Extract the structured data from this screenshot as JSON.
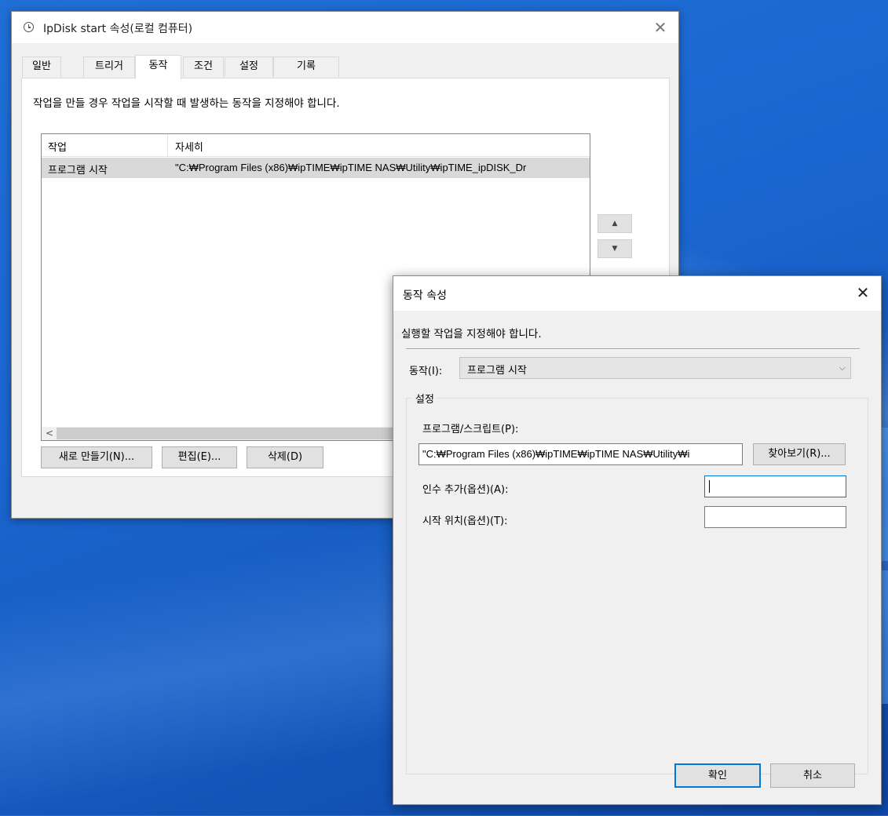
{
  "main_window": {
    "title": "IpDisk start 속성(로컬 컴퓨터)",
    "close_glyph": "✕",
    "icon": "clock-icon",
    "tabs": [
      {
        "label": "일반"
      },
      {
        "label": "트리거"
      },
      {
        "label": "동작",
        "active": true
      },
      {
        "label": "조건"
      },
      {
        "label": "설정"
      },
      {
        "label": "기록"
      }
    ],
    "description": "작업을 만들 경우 작업을 시작할 때 발생하는 동작을 지정해야 합니다.",
    "list": {
      "columns": [
        "작업",
        "자세히"
      ],
      "rows": [
        {
          "action": "프로그램 시작",
          "details": "\"C:₩Program Files (x86)₩ipTIME₩ipTIME NAS₩Utility₩ipTIME_ipDISK_Dr"
        }
      ]
    },
    "move_up_glyph": "▲",
    "move_down_glyph": "▼",
    "scroll_left_glyph": "<",
    "buttons": {
      "new": "새로 만들기(N)...",
      "edit": "편집(E)...",
      "delete": "삭제(D)"
    }
  },
  "action_dialog": {
    "title": "동작 속성",
    "close_glyph": "✕",
    "description": "실행할 작업을 지정해야 합니다.",
    "action_label": "동작(I):",
    "action_value": "프로그램 시작",
    "chevron_glyph": "⌵",
    "group_title": "설정",
    "program_label": "프로그램/스크립트(P):",
    "program_value": "\"C:₩Program Files (x86)₩ipTIME₩ipTIME NAS₩Utility₩i",
    "browse_label": "찾아보기(R)...",
    "args_label": "인수 추가(옵션)(A):",
    "args_value": "",
    "start_in_label": "시작 위치(옵션)(T):",
    "start_in_value": "",
    "ok_label": "확인",
    "cancel_label": "취소"
  },
  "colors": {
    "desktop": "#1a66d0",
    "dialog_bg": "#f0f0f0",
    "selected_row": "#d9d9d9",
    "focus_border": "#0078d7"
  }
}
